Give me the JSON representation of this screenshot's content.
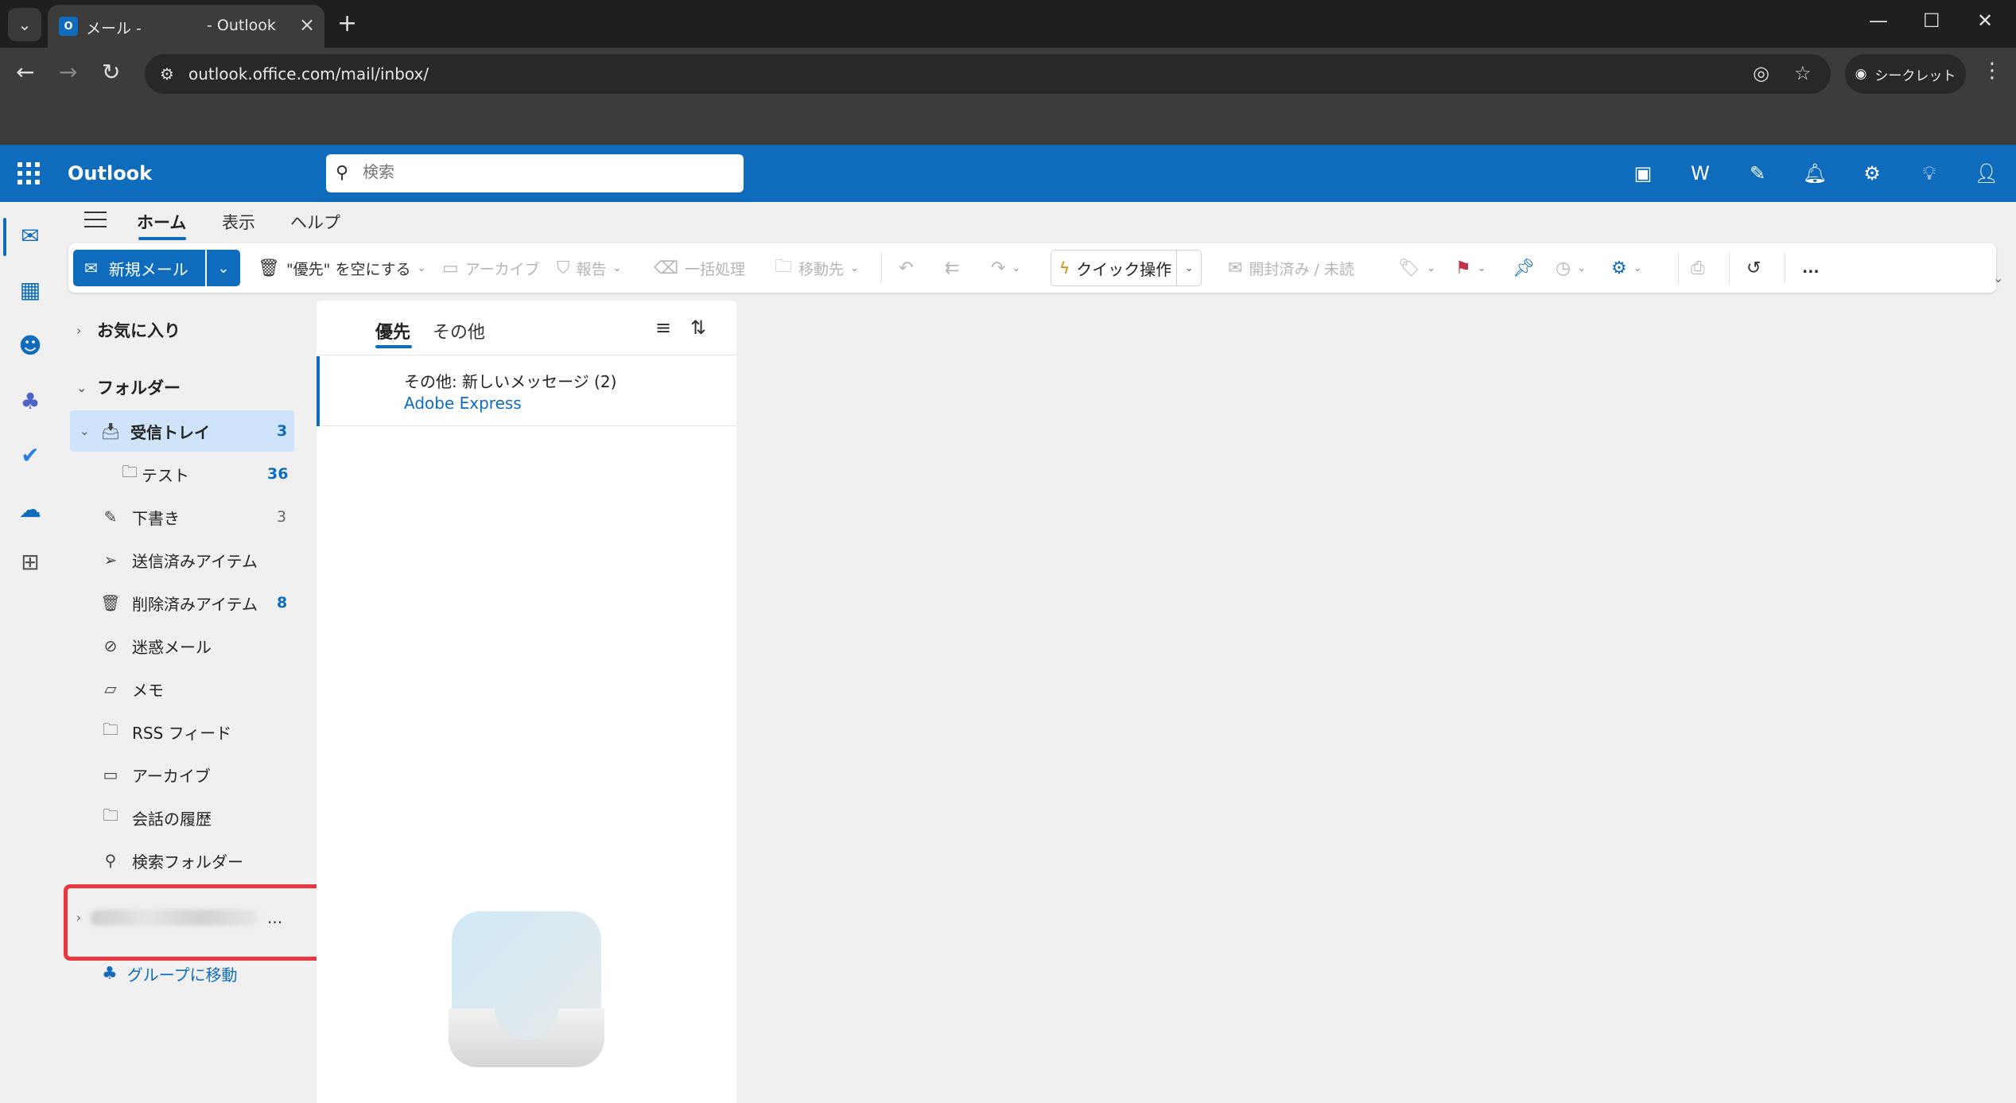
{
  "browser": {
    "tab_title_part1": "メール -",
    "tab_title_part2": "- Outlook",
    "url": "outlook.office.com/mail/inbox/",
    "incognito_label": "シークレット"
  },
  "outlook": {
    "brand": "Outlook",
    "search_placeholder": "検索"
  },
  "ribbon_tabs": [
    "ホーム",
    "表示",
    "ヘルプ"
  ],
  "ribbon": {
    "new_mail": "新規メール",
    "empty_focused": "\"優先\" を空にする",
    "archive": "アーカイブ",
    "report": "報告",
    "sweep": "一括処理",
    "move_to": "移動先",
    "quick_steps": "クイック操作",
    "read_unread": "開封済み / 未読",
    "more": "..."
  },
  "folders": {
    "favorites": "お気に入り",
    "folders_header": "フォルダー",
    "inbox": {
      "name": "受信トレイ",
      "count": "3"
    },
    "test": {
      "name": "テスト",
      "count": "36"
    },
    "drafts": {
      "name": "下書き",
      "count": "3"
    },
    "sent": {
      "name": "送信済みアイテム"
    },
    "deleted": {
      "name": "削除済みアイテム",
      "count": "8"
    },
    "junk": {
      "name": "迷惑メール"
    },
    "notes": {
      "name": "メモ"
    },
    "rss": {
      "name": "RSS フィード"
    },
    "archive": {
      "name": "アーカイブ"
    },
    "conversation": {
      "name": "会話の履歴"
    },
    "search_folders": {
      "name": "検索フォルダー"
    },
    "account_ellipsis": "...",
    "go_to_groups": "グループに移動"
  },
  "message_list": {
    "tabs": [
      "優先",
      "その他"
    ],
    "items": [
      {
        "subject": "その他: 新しいメッセージ (2)",
        "from": "Adobe Express"
      }
    ]
  },
  "colors": {
    "accent": "#0f6cbd",
    "highlight_box": "#e8383f",
    "selected_folder_bg": "#cfe4fa"
  }
}
